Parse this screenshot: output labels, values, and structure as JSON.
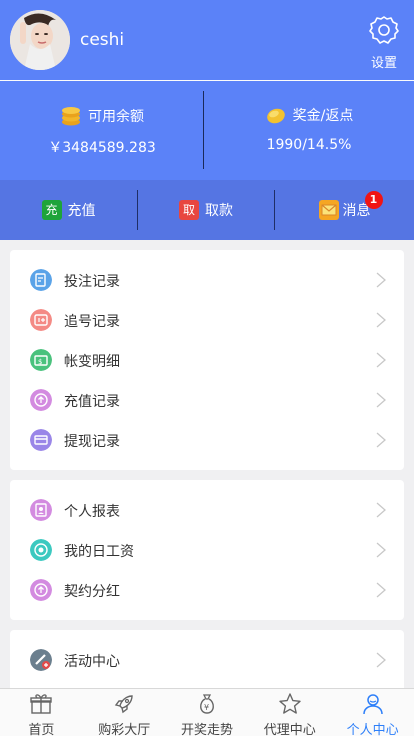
{
  "user": {
    "name": "ceshi"
  },
  "settings": {
    "label": "设置"
  },
  "balance": {
    "available": {
      "title": "可用余额",
      "value": "￥3484589.283"
    },
    "bonus": {
      "title": "奖金/返点",
      "value": "1990/14.5%"
    }
  },
  "actions": {
    "recharge": {
      "label": "充值",
      "chip": "充",
      "chip_color": "#1ea43a"
    },
    "withdraw": {
      "label": "取款",
      "chip": "取",
      "chip_color": "#e8463f"
    },
    "messages": {
      "label": "消息",
      "badge": "1"
    }
  },
  "menu_group_1": [
    {
      "label": "投注记录",
      "icon": "bet-record-icon",
      "color": "#5aa3e8"
    },
    {
      "label": "追号记录",
      "icon": "chase-record-icon",
      "color": "#f48a85"
    },
    {
      "label": "帐变明细",
      "icon": "account-change-icon",
      "color": "#4ac27d"
    },
    {
      "label": "充值记录",
      "icon": "recharge-record-icon",
      "color": "#d38be0"
    },
    {
      "label": "提现记录",
      "icon": "withdraw-record-icon",
      "color": "#9a86e8"
    }
  ],
  "menu_group_2": [
    {
      "label": "个人报表",
      "icon": "personal-report-icon",
      "color": "#d38be0"
    },
    {
      "label": "我的日工资",
      "icon": "daily-wage-icon",
      "color": "#3cc9c0"
    },
    {
      "label": "契约分红",
      "icon": "contract-dividend-icon",
      "color": "#d38be0"
    }
  ],
  "menu_group_3": [
    {
      "label": "活动中心",
      "icon": "activity-center-icon",
      "color": "#6b7f8e"
    }
  ],
  "tabs": [
    {
      "label": "首页",
      "icon": "gift-icon",
      "active": false
    },
    {
      "label": "购彩大厅",
      "icon": "rocket-icon",
      "active": false
    },
    {
      "label": "开奖走势",
      "icon": "money-bag-icon",
      "active": false
    },
    {
      "label": "代理中心",
      "icon": "star-icon",
      "active": false
    },
    {
      "label": "个人中心",
      "icon": "person-icon",
      "active": true
    }
  ],
  "colors": {
    "header": "#5b82f8",
    "actions_bar": "#5575e3",
    "accent": "#2d7ff9",
    "badge": "#f01414"
  }
}
